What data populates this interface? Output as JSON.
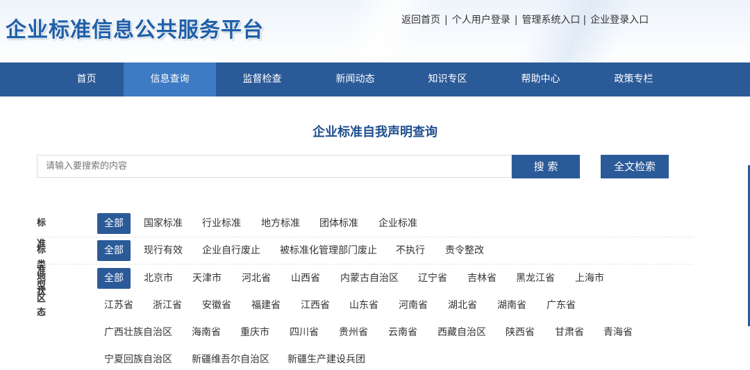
{
  "header": {
    "logo": "企业标准信息公共服务平台",
    "links": [
      "返回首页",
      "个人用户登录",
      "管理系统入口",
      "企业登录入口"
    ],
    "separator": "|"
  },
  "nav": {
    "items": [
      "首页",
      "信息查询",
      "监督检查",
      "新闻动态",
      "知识专区",
      "帮助中心",
      "政策专栏"
    ],
    "active": "信息查询"
  },
  "page_title": "企业标准自我声明查询",
  "search": {
    "placeholder": "请输入要搜索的内容",
    "value": "",
    "search_button": "搜 索",
    "fulltext_button": "全文检索"
  },
  "filters": {
    "type": {
      "label": "标准类型",
      "options": [
        "全部",
        "国家标准",
        "行业标准",
        "地方标准",
        "团体标准",
        "企业标准"
      ],
      "selected": "全部"
    },
    "status": {
      "label": "标准状态",
      "options": [
        "全部",
        "现行有效",
        "企业自行废止",
        "被标准化管理部门废止",
        "不执行",
        "责令整改"
      ],
      "selected": "全部"
    },
    "region": {
      "label": "地区",
      "options": [
        "全部",
        "北京市",
        "天津市",
        "河北省",
        "山西省",
        "内蒙古自治区",
        "辽宁省",
        "吉林省",
        "黑龙江省",
        "上海市",
        "江苏省",
        "浙江省",
        "安徽省",
        "福建省",
        "江西省",
        "山东省",
        "河南省",
        "湖北省",
        "湖南省",
        "广东省",
        "广西壮族自治区",
        "海南省",
        "重庆市",
        "四川省",
        "贵州省",
        "云南省",
        "西藏自治区",
        "陕西省",
        "甘肃省",
        "青海省",
        "宁夏回族自治区",
        "新疆维吾尔自治区",
        "新疆生产建设兵团"
      ],
      "selected": "全部"
    }
  },
  "colors": {
    "primary": "#2b5a98",
    "nav_active": "#3f7ac4",
    "logo": "#1f5fa8",
    "title": "#1f4f8e"
  }
}
